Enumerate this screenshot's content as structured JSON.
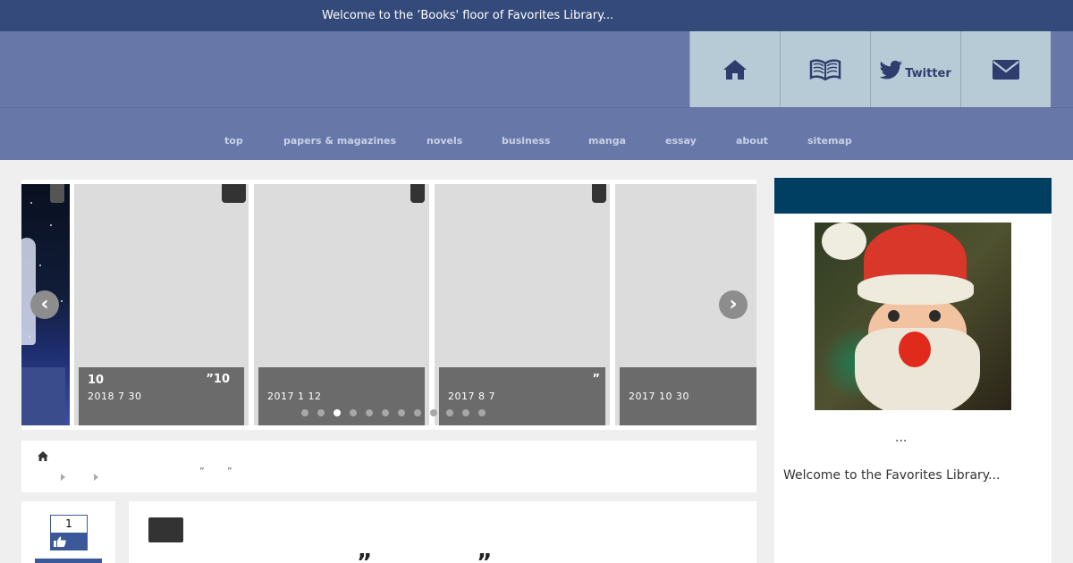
{
  "topbar": {
    "welcome": "Welcome to the ’Books' floor of Favorites Library..."
  },
  "header": {
    "icons": [
      {
        "name": "home-icon"
      },
      {
        "name": "book-icon"
      },
      {
        "name": "twitter-icon",
        "label": "Twitter"
      },
      {
        "name": "mail-icon"
      }
    ]
  },
  "nav": {
    "items": [
      "top",
      "papers & magazines",
      "novels",
      "business",
      "manga",
      "essay",
      "about",
      "sitemap"
    ]
  },
  "carousel": {
    "slides": [
      {
        "num": "10",
        "quote": "”10",
        "date": "2018  7  30"
      },
      {
        "num": "",
        "quote": "",
        "date": "2017  1  12"
      },
      {
        "num": "",
        "quote": "”",
        "date": "2017  8  7"
      },
      {
        "num": "",
        "quote": "",
        "date": "2017  10  30"
      }
    ],
    "prev_label": "‹",
    "next_label": "›",
    "dot_count": 12,
    "active_dot": 3
  },
  "breadcrumb": {
    "quote_1": "”",
    "quote_2": "”"
  },
  "share": {
    "like_count": "1"
  },
  "article": {
    "title": "” ”"
  },
  "sidebar": {
    "ellipsis": "...",
    "welcome": "Welcome to the Favorites Library..."
  },
  "colors": {
    "topbar": "#344a7b",
    "header": "#6677a8",
    "icon_box": "#b7cbd6",
    "sidebar_head": "#003f62",
    "facebook": "#3b5998"
  }
}
